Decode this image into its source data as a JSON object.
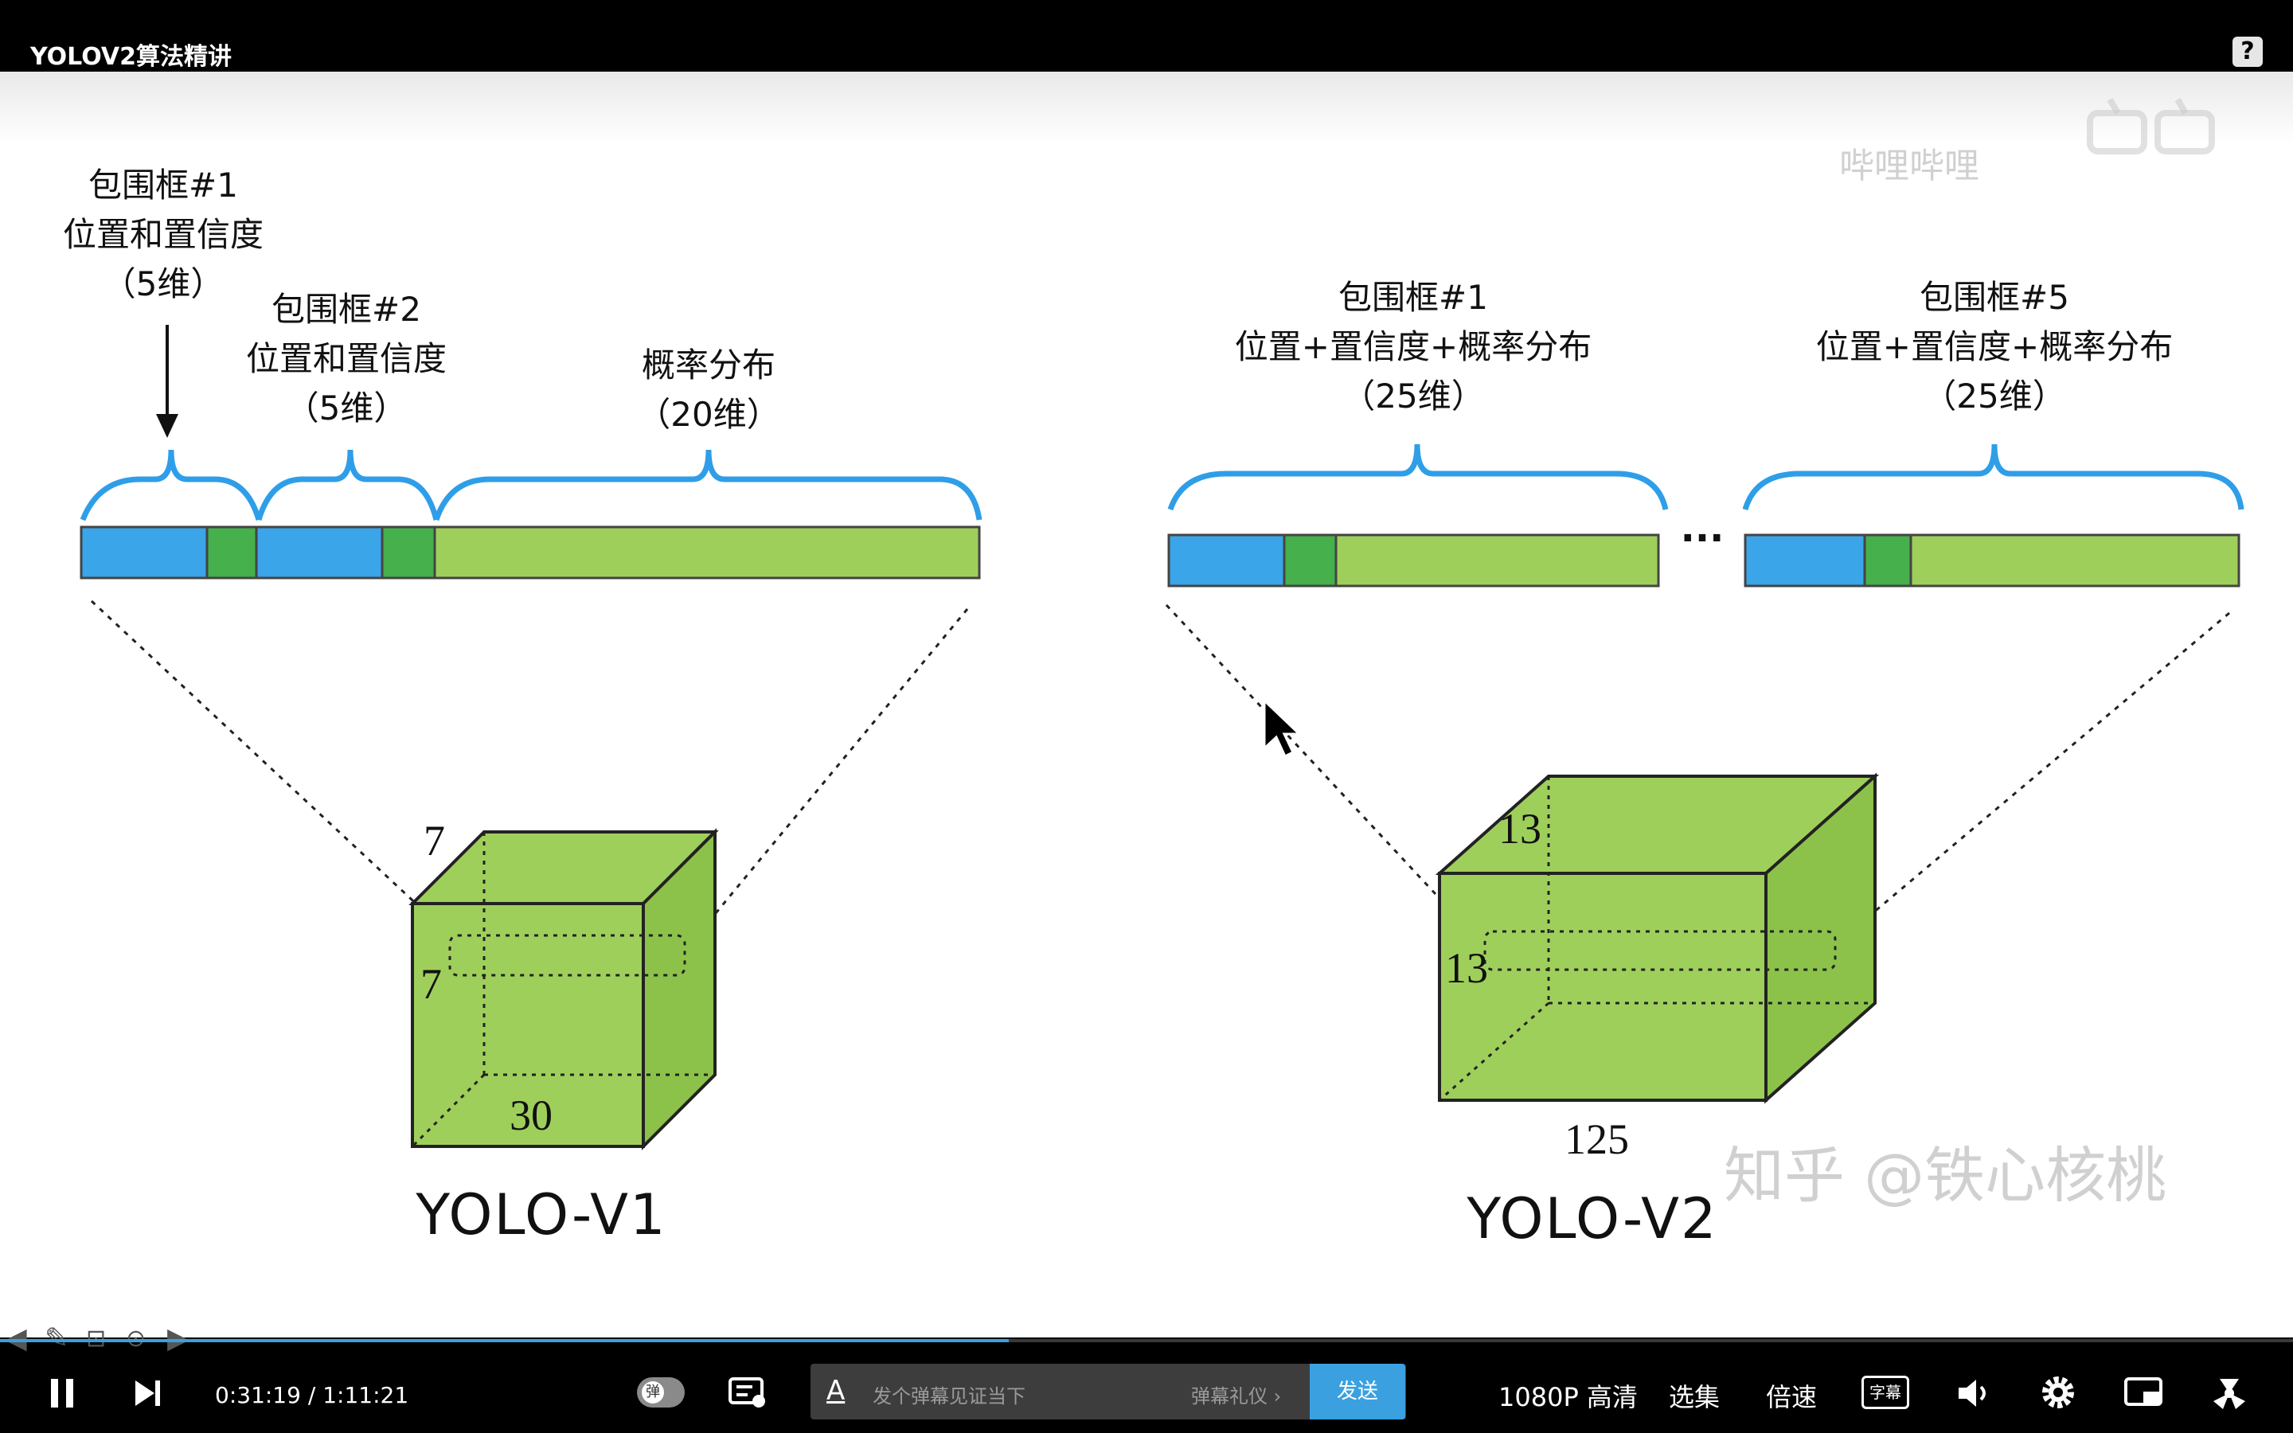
{
  "app": {
    "title": "YOLOV2算法精讲",
    "help_icon": "?"
  },
  "slide": {
    "v1": {
      "box1": "包围框#1\n位置和置信度\n（5维）",
      "box2": "包围框#2\n位置和置信度\n（5维）",
      "prob": "概率分布\n（20维）",
      "dim_top": "7",
      "dim_side": "7",
      "dim_bottom": "30",
      "name": "YOLO-V1"
    },
    "v2": {
      "box1": "包围框#1\n位置+置信度+概率分布\n（25维）",
      "box5": "包围框#5\n位置+置信度+概率分布\n（25维）",
      "ellipsis": "···",
      "dim_top": "13",
      "dim_side": "13",
      "dim_bottom": "125",
      "name": "YOLO-V2"
    },
    "colors": {
      "blue": "#3aa5e8",
      "dark_green": "#45b04c",
      "light_green": "#9fcf5b",
      "brace": "#2f9ee8"
    }
  },
  "watermarks": {
    "corner": "哔哩哔哩",
    "zhihu": "知乎 @铁心核桃"
  },
  "annotation_toolbar": {
    "icons": [
      "arrow-left-icon",
      "pen-icon",
      "square-icon",
      "dots-icon",
      "arrow-right-icon"
    ]
  },
  "player": {
    "progress_fraction": 0.44,
    "current_time": "0:31:19",
    "separator": "/",
    "total_time": "1:11:21",
    "danmu_toggle": "弹",
    "danmu_placeholder": "发个弹幕见证当下",
    "danmu_etiquette": "弹幕礼仪 ›",
    "send_label": "发送",
    "quality": "1080P 高清",
    "episodes": "选集",
    "speed": "倍速",
    "subtitle_icon": "字幕"
  }
}
